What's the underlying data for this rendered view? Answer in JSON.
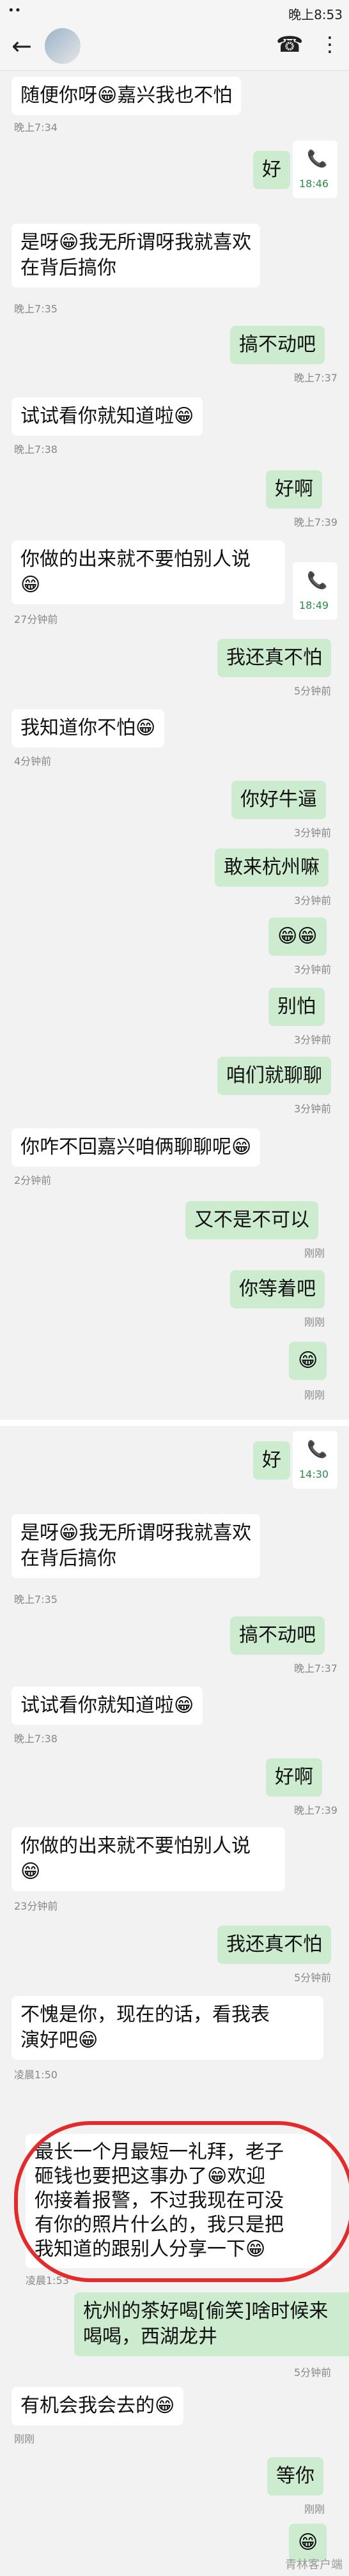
{
  "status": {
    "left": "••",
    "right": "晚上8:53"
  },
  "header": {
    "back": "←",
    "phone": "☎",
    "more": "⋮"
  },
  "messages": [
    {
      "text": "随便你呀😁嘉兴我也不怕",
      "time": "晚上7:34"
    },
    {
      "text": "好",
      "call_time": "18:46"
    },
    {
      "text": "是呀😁我无所谓呀我就喜欢\n在背后搞你",
      "time": "晚上7:35"
    },
    {
      "text": "搞不动吧",
      "time": "晚上7:37"
    },
    {
      "text": "试试看你就知道啦😁",
      "time": "晚上7:38"
    },
    {
      "text": "好啊",
      "time": "晚上7:39"
    },
    {
      "text": "你做的出来就不要怕别人说\n😁",
      "time": "27分钟前",
      "call_time": "18:49"
    },
    {
      "text": "我还真不怕",
      "time": "5分钟前"
    },
    {
      "text": "我知道你不怕😁",
      "time": "4分钟前"
    },
    {
      "text": "你好牛逼",
      "time": "3分钟前"
    },
    {
      "text": "敢来杭州嘛",
      "time": "3分钟前"
    },
    {
      "text": "😁😁",
      "time": "3分钟前"
    },
    {
      "text": "别怕",
      "time": "3分钟前"
    },
    {
      "text": "咱们就聊聊",
      "time": "3分钟前"
    },
    {
      "text": "你咋不回嘉兴咱俩聊聊呢😁",
      "time": "2分钟前"
    },
    {
      "text": "又不是不可以",
      "time": "刚刚"
    },
    {
      "text": "你等着吧",
      "time": "刚刚"
    },
    {
      "text": "😁",
      "time": "刚刚"
    },
    {
      "text": "好",
      "call_time": "14:30"
    },
    {
      "text": "是呀😁我无所谓呀我就喜欢\n在背后搞你",
      "time": "晚上7:35"
    },
    {
      "text": "搞不动吧",
      "time": "晚上7:37"
    },
    {
      "text": "试试看你就知道啦😁",
      "time": "晚上7:38"
    },
    {
      "text": "好啊",
      "time": "晚上7:39"
    },
    {
      "text": "你做的出来就不要怕别人说\n😁",
      "time": "23分钟前"
    },
    {
      "text": "我还真不怕",
      "time": "5分钟前"
    },
    {
      "text": "不愧是你，现在的话，看我表\n演好吧😁",
      "time": "凌晨1:50"
    },
    {
      "text": "最长一个月最短一礼拜，老子\n砸钱也要把这事办了😁欢迎\n你接着报警，不过我现在可没\n有你的照片什么的，我只是把\n我知道的跟别人分享一下😁",
      "time": "凌晨1:53"
    },
    {
      "text": "杭州的茶好喝[偷笑]啥时候来\n喝喝，西湖龙井",
      "time": "5分钟前"
    },
    {
      "text": "有机会我会去的😁",
      "time": "刚刚"
    },
    {
      "text": "等你",
      "time": "刚刚"
    },
    {
      "text": "😁"
    }
  ],
  "watermark": "青林客户端",
  "call_icon": "📞"
}
